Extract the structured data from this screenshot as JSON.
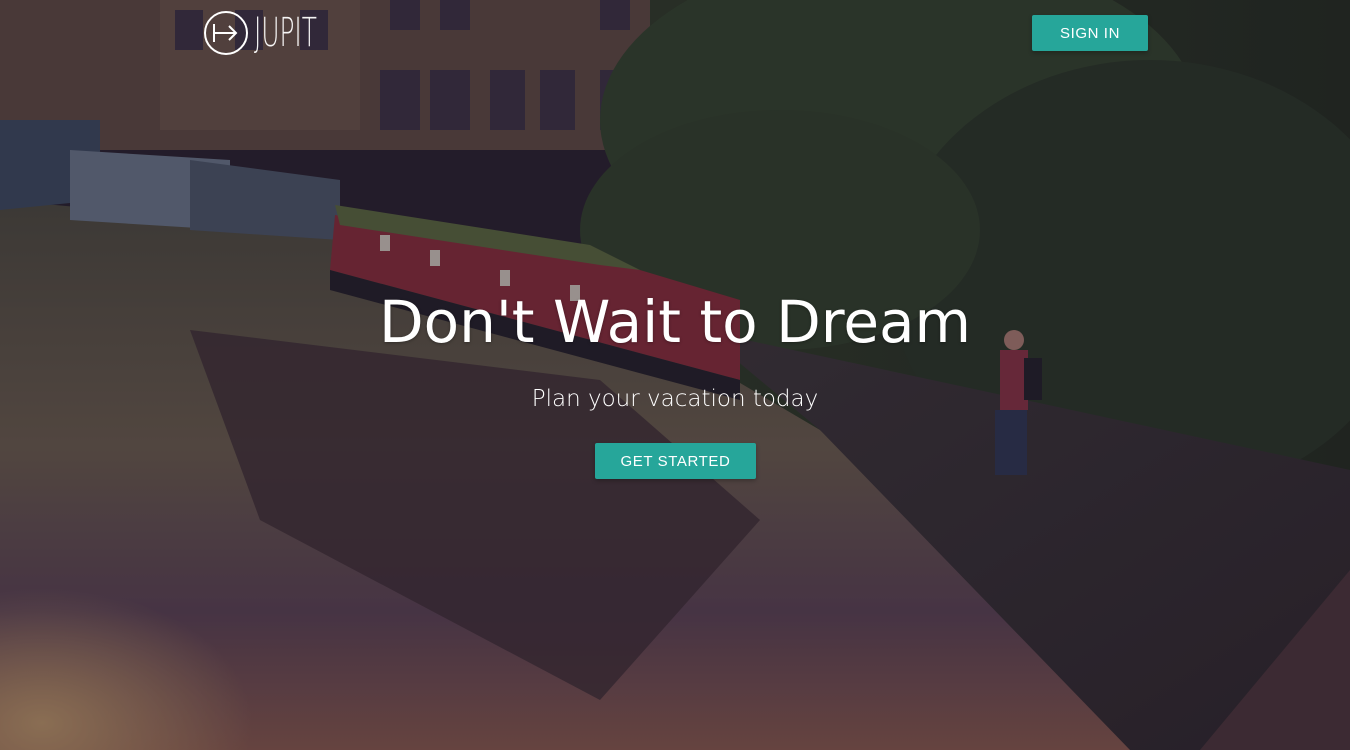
{
  "header": {
    "logo_text": "JUPIT",
    "logo_icon": "arrow-in-circle-icon",
    "sign_in_label": "SIGN IN"
  },
  "hero": {
    "headline": "Don't Wait to Dream",
    "subheadline": "Plan your vacation today",
    "cta_label": "GET STARTED",
    "background": "canal-with-narrowboats-photo"
  },
  "colors": {
    "accent": "#26a69a",
    "text": "#ffffff"
  }
}
